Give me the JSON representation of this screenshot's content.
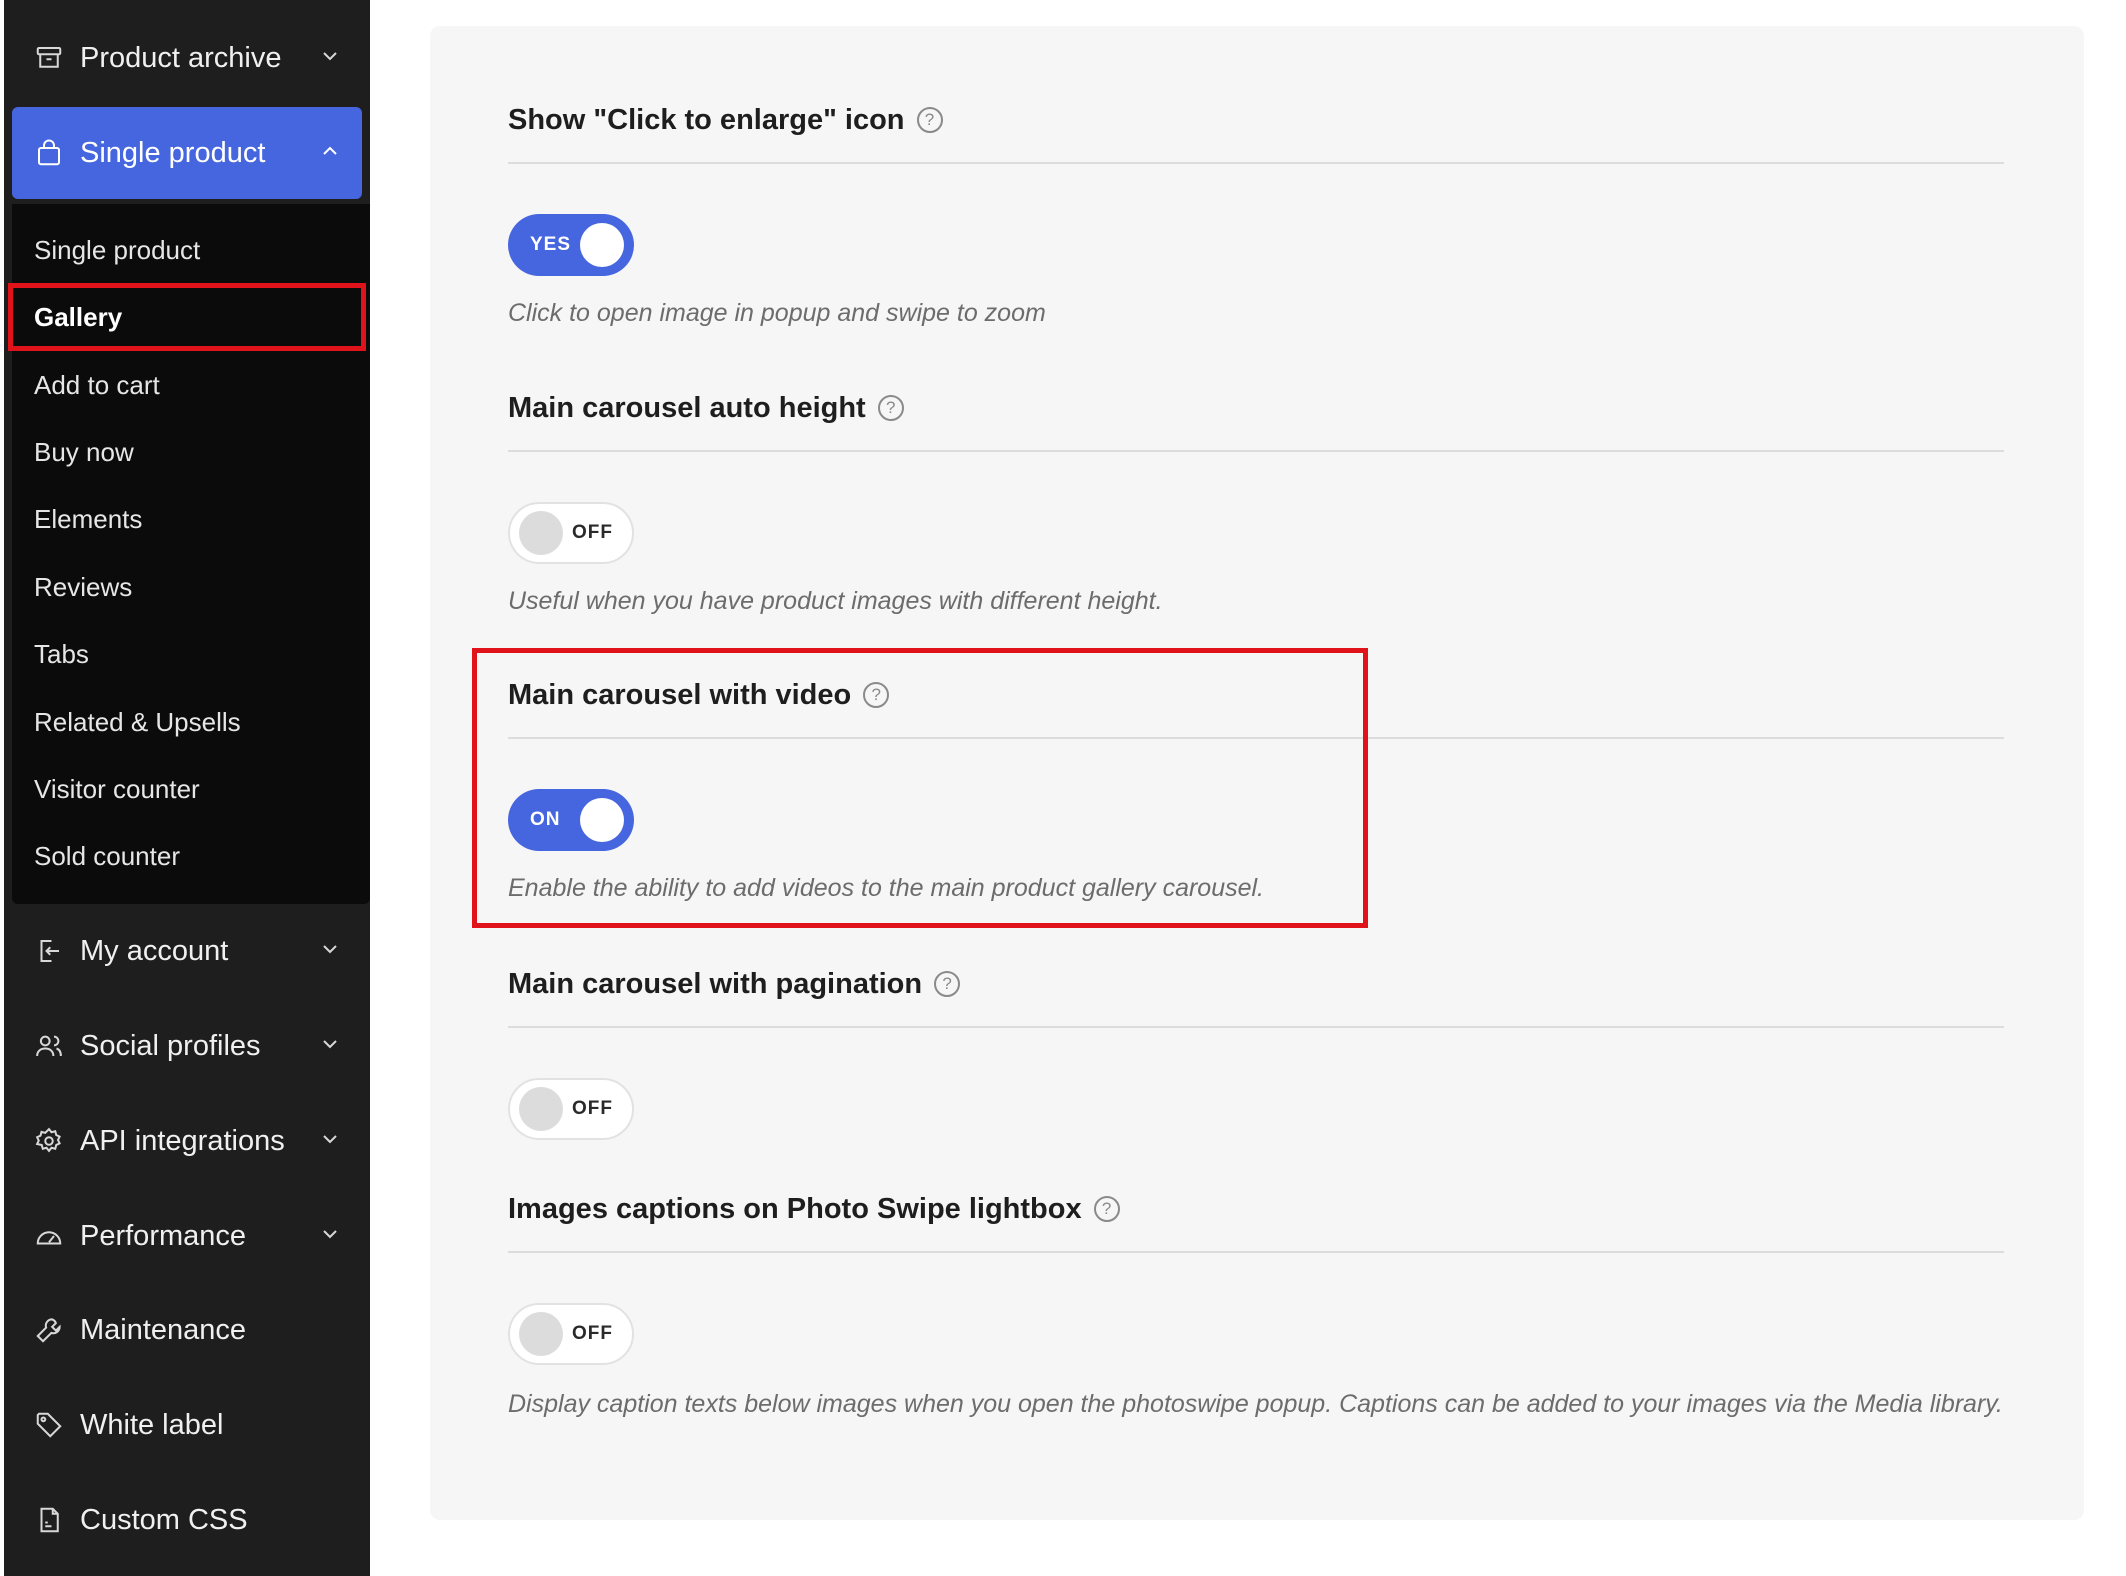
{
  "sidebar": {
    "top_items": [
      {
        "label": "Product archive",
        "icon": "archive-icon",
        "expanded": false
      },
      {
        "label": "Single product",
        "icon": "shopping-bag-icon",
        "expanded": true
      }
    ],
    "submenu": [
      {
        "label": "Single product"
      },
      {
        "label": "Gallery"
      },
      {
        "label": "Add to cart"
      },
      {
        "label": "Buy now"
      },
      {
        "label": "Elements"
      },
      {
        "label": "Reviews"
      },
      {
        "label": "Tabs"
      },
      {
        "label": "Related & Upsells"
      },
      {
        "label": "Visitor counter"
      },
      {
        "label": "Sold counter"
      }
    ],
    "bottom_items": [
      {
        "label": "My account",
        "icon": "login-icon",
        "has_chevron": true
      },
      {
        "label": "Social profiles",
        "icon": "users-icon",
        "has_chevron": true
      },
      {
        "label": "API integrations",
        "icon": "gear-icon",
        "has_chevron": true
      },
      {
        "label": "Performance",
        "icon": "gauge-icon",
        "has_chevron": true
      },
      {
        "label": "Maintenance",
        "icon": "wrench-icon",
        "has_chevron": false
      },
      {
        "label": "White label",
        "icon": "tag-icon",
        "has_chevron": false
      },
      {
        "label": "Custom CSS",
        "icon": "css-file-icon",
        "has_chevron": false
      }
    ]
  },
  "settings": [
    {
      "title": "Show \"Click to enlarge\" icon",
      "toggle": "YES",
      "state": "on",
      "description": "Click to open image in popup and swipe to zoom"
    },
    {
      "title": "Main carousel auto height",
      "toggle": "OFF",
      "state": "off",
      "description": "Useful when you have product images with different height."
    },
    {
      "title": "Main carousel with video",
      "toggle": "ON",
      "state": "on",
      "description": "Enable the ability to add videos to the main product gallery carousel."
    },
    {
      "title": "Main carousel with pagination",
      "toggle": "OFF",
      "state": "off",
      "description": ""
    },
    {
      "title": "Images captions on Photo Swipe lightbox",
      "toggle": "OFF",
      "state": "off",
      "description": "Display caption texts below images when you open the photoswipe popup. Captions can be added to your images via the Media library."
    }
  ],
  "help_glyph": "?",
  "colors": {
    "accent": "#4666e0",
    "highlight": "#e0131a",
    "sidebar_bg": "#1e1e1e"
  }
}
